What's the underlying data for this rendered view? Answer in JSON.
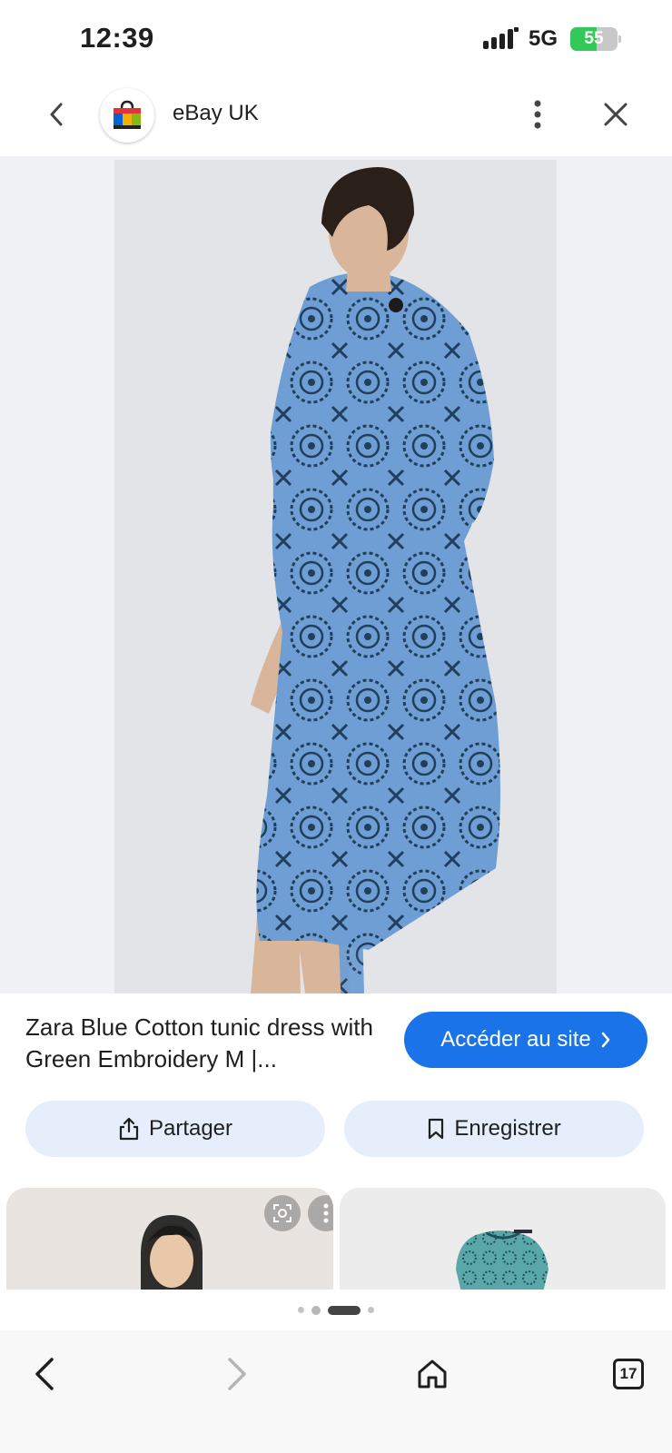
{
  "status_bar": {
    "time": "12:39",
    "network": "5G",
    "battery": "55",
    "battery_level": 0.55
  },
  "header": {
    "site_name": "eBay UK",
    "logo_icon": "ebay-shopping-bag-icon"
  },
  "product": {
    "title": "Zara Blue Cotton tunic dress with Green Embroidery M |...",
    "visit_label": "Accéder au site"
  },
  "actions": {
    "share_label": "Partager",
    "save_label": "Enregistrer"
  },
  "pager": {
    "count": 4,
    "active_index": 2
  },
  "bottom_nav": {
    "tab_count": "17"
  },
  "colors": {
    "accent": "#1a73e8",
    "pill": "#e6eefb",
    "dress_blue": "#6f9ed4",
    "pattern": "#1f3f5c"
  }
}
